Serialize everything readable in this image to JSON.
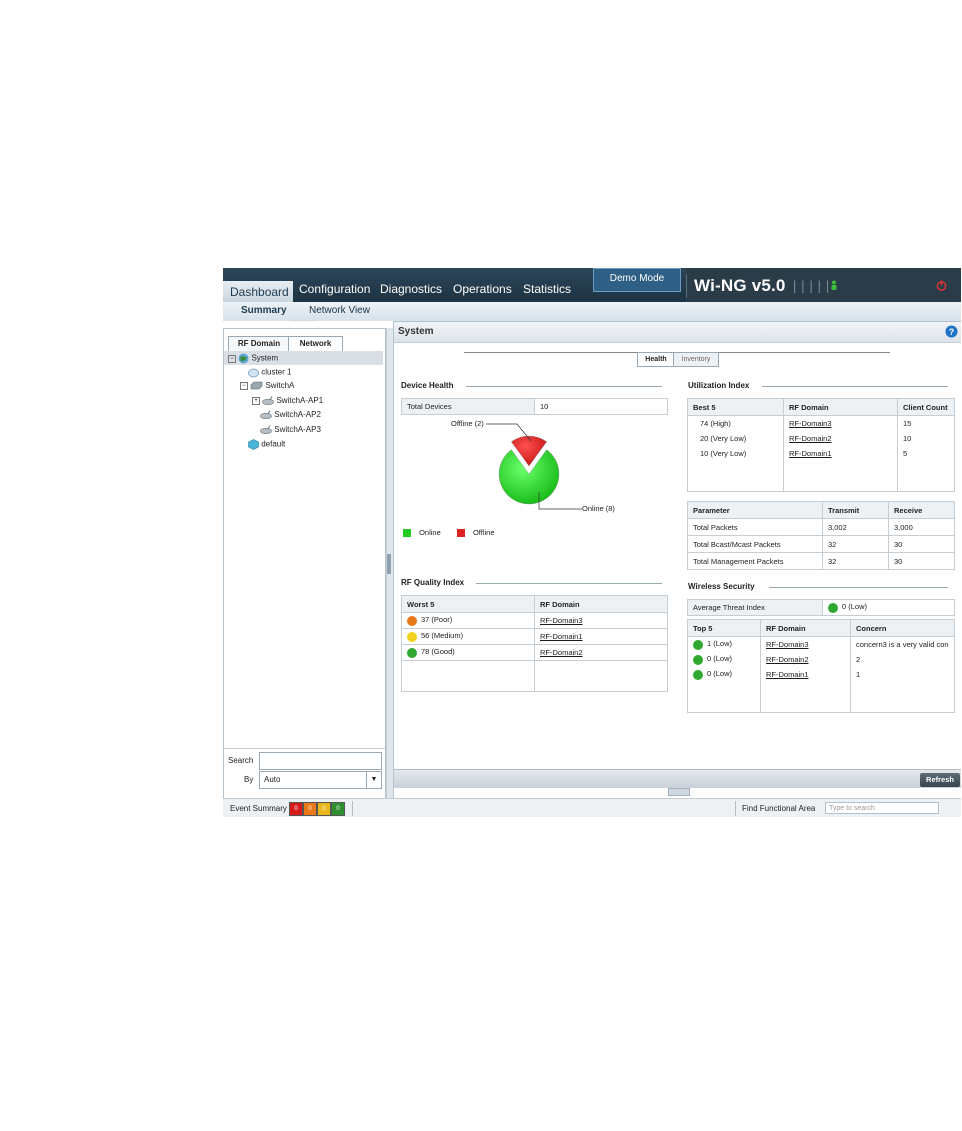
{
  "topnav": {
    "items": [
      "Dashboard",
      "Configuration",
      "Diagnostics",
      "Operations",
      "Statistics"
    ],
    "demo_mode": "Demo Mode",
    "brand": "Wi-NG v5.0",
    "brand_bars": "|||||"
  },
  "subnav": {
    "summary": "Summary",
    "network_view": "Network View"
  },
  "left": {
    "tabs": [
      "RF Domain",
      "Network"
    ],
    "tree": [
      "System",
      "cluster 1",
      "SwitchA",
      "SwitchA-AP1",
      "SwitchA-AP2",
      "SwitchA-AP3",
      "default"
    ],
    "search_label": "Search",
    "by_label": "By",
    "by_value": "Auto"
  },
  "main": {
    "title": "System",
    "tabs": [
      "Health",
      "Inventory"
    ],
    "device_health": {
      "title": "Device Health",
      "total_label": "Total Devices",
      "total_value": "10",
      "offline_label": "Offline (2)",
      "online_label": "Online (8)",
      "legend": [
        "Online",
        "Offline"
      ]
    },
    "rf_quality": {
      "title": "RF Quality Index",
      "headers": [
        "Worst 5",
        "RF Domain"
      ],
      "rows": [
        {
          "value": "37 (Poor)",
          "domain": "RF-Domain3",
          "status": "poor"
        },
        {
          "value": "56 (Medium)",
          "domain": "RF-Domain1",
          "status": "medium"
        },
        {
          "value": "78 (Good)",
          "domain": "RF-Domain2",
          "status": "good"
        }
      ]
    },
    "utilization": {
      "title": "Utilization Index",
      "headers": [
        "Best 5",
        "RF Domain",
        "Client Count"
      ],
      "rows": [
        {
          "value": "74 (High)",
          "domain": "RF-Domain3",
          "count": "15"
        },
        {
          "value": "20 (Very Low)",
          "domain": "RF-Domain2",
          "count": "10"
        },
        {
          "value": "10 (Very Low)",
          "domain": "RF-Domain1",
          "count": "5"
        }
      ]
    },
    "packets": {
      "headers": [
        "Parameter",
        "Transmit",
        "Receive"
      ],
      "rows": [
        {
          "param": "Total Packets",
          "tx": "3,002",
          "rx": "3,000"
        },
        {
          "param": "Total Bcast/Mcast Packets",
          "tx": "32",
          "rx": "30"
        },
        {
          "param": "Total Management Packets",
          "tx": "32",
          "rx": "30"
        }
      ]
    },
    "wireless_security": {
      "title": "Wireless Security",
      "avg_label": "Average Threat Index",
      "avg_value": "0 (Low)",
      "headers": [
        "Top 5",
        "RF Domain",
        "Concern"
      ],
      "rows": [
        {
          "value": "1 (Low)",
          "domain": "RF-Domain3",
          "concern": "concern3 is a very valid con"
        },
        {
          "value": "0 (Low)",
          "domain": "RF-Domain2",
          "concern": "2"
        },
        {
          "value": "0 (Low)",
          "domain": "RF-Domain1",
          "concern": "1"
        }
      ]
    },
    "refresh": "Refresh"
  },
  "statusbar": {
    "event_summary": "Event Summary",
    "events": [
      {
        "count": "0",
        "color": "#d41a1a"
      },
      {
        "count": "0",
        "color": "#e8781a"
      },
      {
        "count": "0",
        "color": "#e8b81a"
      },
      {
        "count": "0",
        "color": "#2f8f2f"
      }
    ],
    "find_label": "Find Functional Area",
    "find_placeholder": "Type to search"
  },
  "colors": {
    "online": "#22cc22",
    "offline": "#dd2222",
    "nav_bg": "#2c4658",
    "accent": "#2e5f85"
  }
}
